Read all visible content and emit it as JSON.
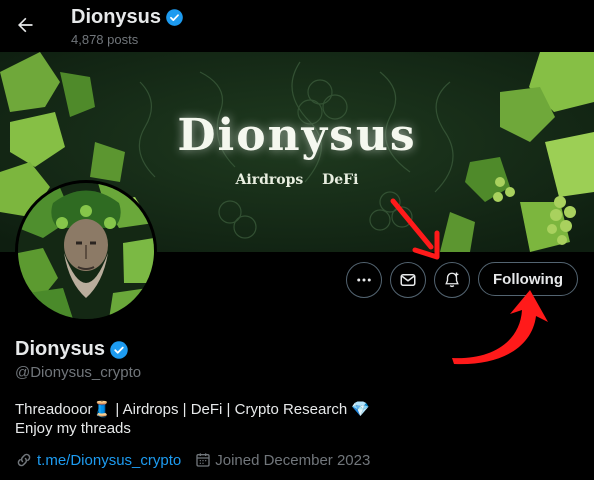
{
  "header": {
    "title": "Dionysus",
    "posts_count": "4,878 posts"
  },
  "banner": {
    "title": "Dionysus",
    "subtitle": "Airdrops DeFi"
  },
  "actions": {
    "following_label": "Following"
  },
  "profile": {
    "name": "Dionysus",
    "handle": "@Dionysus_crypto",
    "bio_line1": "Threadooor🧵 | Airdrops | DeFi | Crypto Research 💎",
    "bio_line2": "Enjoy my threads",
    "link": "t.me/Dionysus_crypto",
    "joined": "Joined December 2023"
  },
  "icons": {
    "back": "arrow-left-icon",
    "verified": "verified-badge-icon",
    "more": "more-icon",
    "message": "envelope-icon",
    "notify": "bell-plus-icon",
    "link": "link-icon",
    "calendar": "calendar-icon"
  },
  "colors": {
    "background": "#000000",
    "text": "#e7e9ea",
    "muted": "#71767b",
    "accent": "#1d9bf0",
    "annotation": "#ff1a1a"
  }
}
